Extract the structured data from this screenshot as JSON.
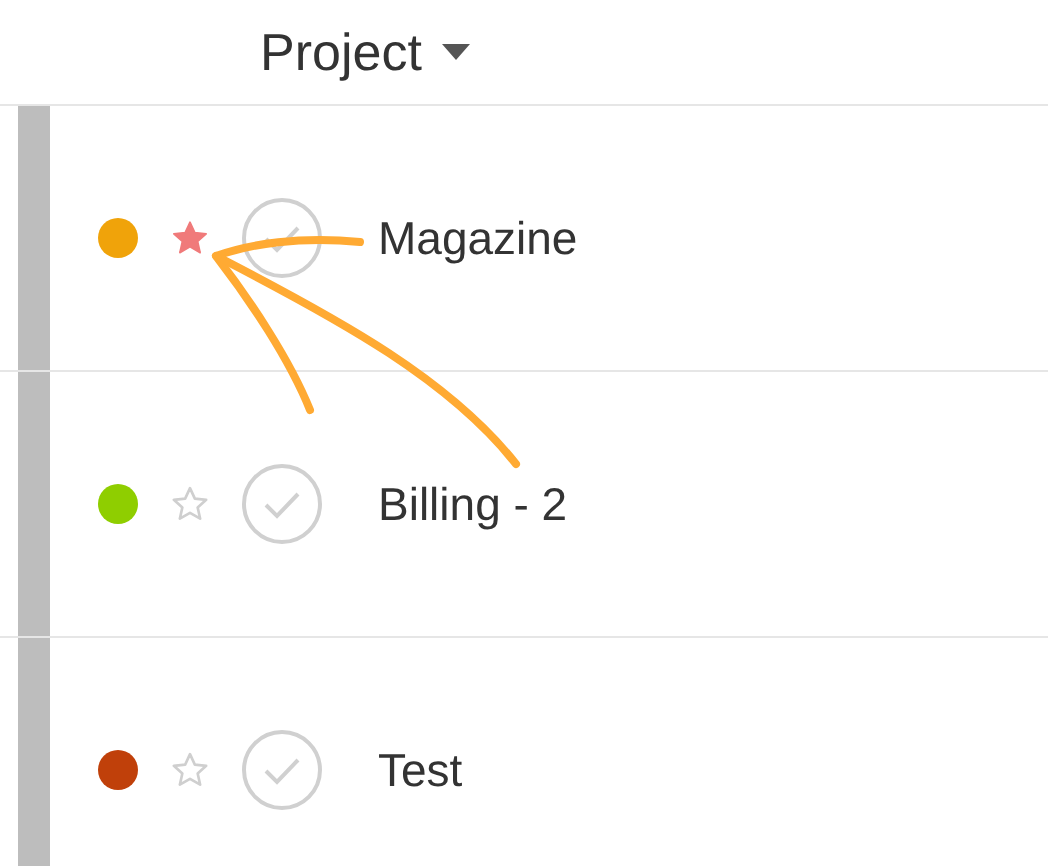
{
  "table": {
    "columns": [
      {
        "label": "Project",
        "sortable": true
      }
    ],
    "rows": [
      {
        "color": "#f0a30a",
        "starred": true,
        "name": "Magazine"
      },
      {
        "color": "#8fce00",
        "starred": false,
        "name": "Billing - 2"
      },
      {
        "color": "#c0400a",
        "starred": false,
        "name": "Test"
      }
    ]
  }
}
